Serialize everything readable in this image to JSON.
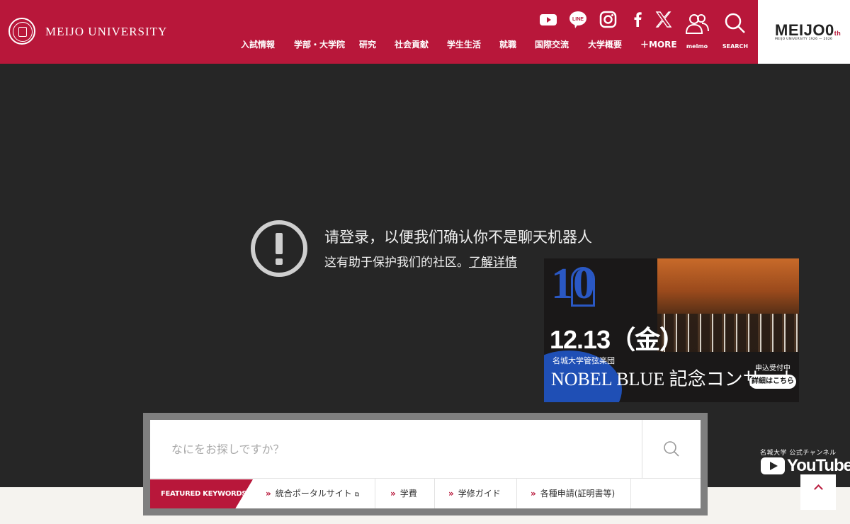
{
  "header": {
    "university_name": "MEIJO UNIVERSITY",
    "nav": [
      "入試情報",
      "学部・大学院",
      "研究",
      "社会貢献",
      "学生生活",
      "就職",
      "国際交流",
      "大学概要",
      "＋MORE"
    ],
    "social": [
      "youtube-icon",
      "line-icon",
      "instagram-icon",
      "facebook-icon",
      "x-icon"
    ],
    "line_label": "LINE",
    "melmo_label": "melmo",
    "search_label": "SEARCH",
    "brand": {
      "word_main": "MEIJO",
      "word_suffix": "0",
      "word_sup": "th",
      "sub": "MEIJO UNIVERSITY 1926 — 2026"
    },
    "accent_color": "#b8173a"
  },
  "notice": {
    "title": "请登录，以便我们确认你不是聊天机器人",
    "subtitle": "这有助于保护我们的社区。",
    "link": "了解详情"
  },
  "banner": {
    "number": "10",
    "date": "12.13（金）",
    "org": "名城大学管弦楽団",
    "concert": "NOBEL BLUE 記念コンサート",
    "accepting": "申込受付中",
    "detail": "詳細はこちら"
  },
  "search": {
    "placeholder": "なにをお探しですか？",
    "keywords_label": "FEATURED KEYWORDS",
    "keywords": [
      "統合ポータルサイト",
      "学費",
      "学修ガイド",
      "各種申請(証明書等)"
    ]
  },
  "youtube": {
    "caption": "名城大学 公式チャンネル",
    "wordmark": "YouTube"
  }
}
